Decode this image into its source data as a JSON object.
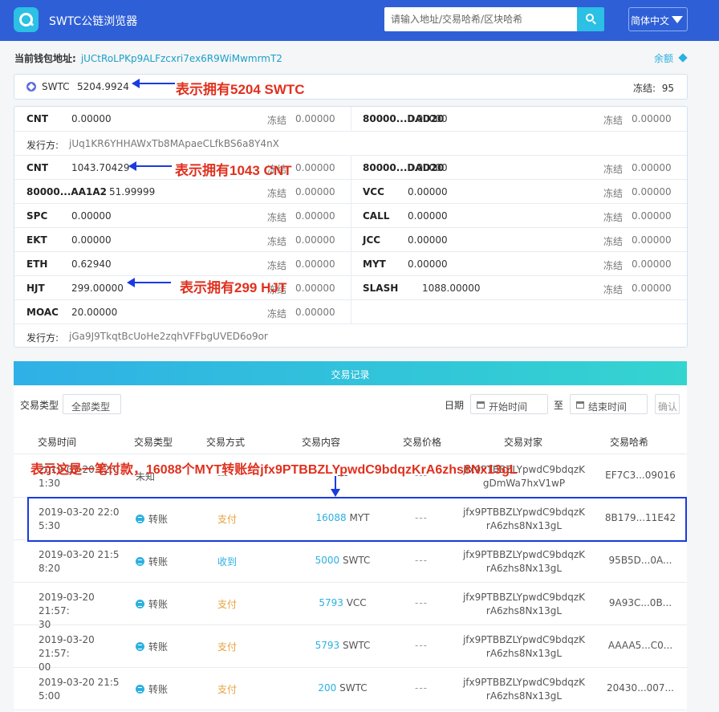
{
  "header": {
    "app_title": "SWTC公链浏览器",
    "search_placeholder": "请输入地址/交易哈希/区块哈希",
    "language": "简体中文"
  },
  "wallet": {
    "label": "当前钱包地址:",
    "address": "jUCtRoLPKp9ALFzcxri7ex6R9WiMwmrmT2",
    "balance_link": "余额"
  },
  "swtc": {
    "symbol": "SWTC",
    "amount": "5204.9924",
    "frozen_label": "冻结:",
    "frozen_value": "95"
  },
  "frozen_label": "冻结",
  "tokens": {
    "row1": {
      "left": {
        "symbol": "CNT",
        "amount": "0.00000",
        "frozen": "0.00000"
      },
      "right": {
        "symbol": "80000...DAD20",
        "amount": "0.00000",
        "frozen": "0.00000"
      }
    },
    "issuer1": {
      "label": "发行方:",
      "value": "jUq1KR6YHHAWxTb8MApaeCLfkBS6a8Y4nX"
    },
    "row2": {
      "left": {
        "symbol": "CNT",
        "amount": "1043.70429",
        "frozen": "0.00000"
      },
      "right": {
        "symbol": "80000...DAD20",
        "amount": "0.00000",
        "frozen": "0.00000"
      }
    },
    "row3": {
      "left": {
        "symbol": "80000...AA1A2",
        "amount": "51.99999",
        "frozen": "0.00000"
      },
      "right": {
        "symbol": "VCC",
        "amount": "0.00000",
        "frozen": "0.00000"
      }
    },
    "row4": {
      "left": {
        "symbol": "SPC",
        "amount": "0.00000",
        "frozen": "0.00000"
      },
      "right": {
        "symbol": "CALL",
        "amount": "0.00000",
        "frozen": "0.00000"
      }
    },
    "row5": {
      "left": {
        "symbol": "EKT",
        "amount": "0.00000",
        "frozen": "0.00000"
      },
      "right": {
        "symbol": "JCC",
        "amount": "0.00000",
        "frozen": "0.00000"
      }
    },
    "row6": {
      "left": {
        "symbol": "ETH",
        "amount": "0.62940",
        "frozen": "0.00000"
      },
      "right": {
        "symbol": "MYT",
        "amount": "0.00000",
        "frozen": "0.00000"
      }
    },
    "row7": {
      "left": {
        "symbol": "HJT",
        "amount": "299.00000",
        "frozen": "0.00000"
      },
      "right": {
        "symbol": "SLASH",
        "amount": "1088.00000",
        "frozen": "0.00000"
      }
    },
    "row8": {
      "left": {
        "symbol": "MOAC",
        "amount": "20.00000",
        "frozen": "0.00000"
      }
    },
    "issuer2": {
      "label": "发行方:",
      "value": "jGa9J9TkqtBcUoHe2zqhVFFbgUVED6o9or"
    }
  },
  "transactions": {
    "title": "交易记录",
    "filter_label": "交易类型",
    "filter_value": "全部类型",
    "date_label": "日期",
    "start_placeholder": "开始时间",
    "to_label": "至",
    "end_placeholder": "结束时间",
    "confirm": "确认",
    "columns": [
      "交易时间",
      "交易类型",
      "交易方式",
      "交易内容",
      "交易价格",
      "交易对家",
      "交易哈希"
    ],
    "rows": [
      {
        "time": "2019-03-20 22:0\n1:30",
        "type": "未知",
        "method": "---",
        "amount": "",
        "token": "---",
        "price": "---",
        "party": "jfx9PTBBZLYpwdC9bdqzK\ngDmWa7hxV1wP",
        "hash": "EF7C3...09016"
      },
      {
        "time": "2019-03-20 22:0\n5:30",
        "type": "转账",
        "method": "支付",
        "amount": "16088",
        "token": "MYT",
        "price": "---",
        "party": "jfx9PTBBZLYpwdC9bdqzK\nrA6zhs8Nx13gL",
        "hash": "8B179...11E42"
      },
      {
        "time": "2019-03-20 21:5\n8:20",
        "type": "转账",
        "method": "收到",
        "amount": "5000",
        "token": "SWTC",
        "price": "---",
        "party": "jfx9PTBBZLYpwdC9bdqzK\nrA6zhs8Nx13gL",
        "hash": "95B5D...0A..."
      },
      {
        "time": "2019-03-20 21:57:\n30",
        "type": "转账",
        "method": "支付",
        "amount": "5793",
        "token": "VCC",
        "price": "---",
        "party": "jfx9PTBBZLYpwdC9bdqzK\nrA6zhs8Nx13gL",
        "hash": "9A93C...0B..."
      },
      {
        "time": "2019-03-20 21:57:\n00",
        "type": "转账",
        "method": "支付",
        "amount": "5793",
        "token": "SWTC",
        "price": "---",
        "party": "jfx9PTBBZLYpwdC9bdqzK\nrA6zhs8Nx13gL",
        "hash": "AAAA5...C0..."
      },
      {
        "time": "2019-03-20 21:5\n5:00",
        "type": "转账",
        "method": "支付",
        "amount": "200",
        "token": "SWTC",
        "price": "---",
        "party": "jfx9PTBBZLYpwdC9bdqzK\nrA6zhs8Nx13gL",
        "hash": "20430...007..."
      }
    ]
  },
  "annotations": {
    "swtc": "表示拥有5204 SWTC",
    "cnt": "表示拥有1043 CNT",
    "hjt": "表示拥有299 HJT",
    "payment": "表示这是一笔付款，16088个MYT转账给jfx9PTBBZLYpwdC9bdqzKrA6zhs8Nx13gL"
  }
}
